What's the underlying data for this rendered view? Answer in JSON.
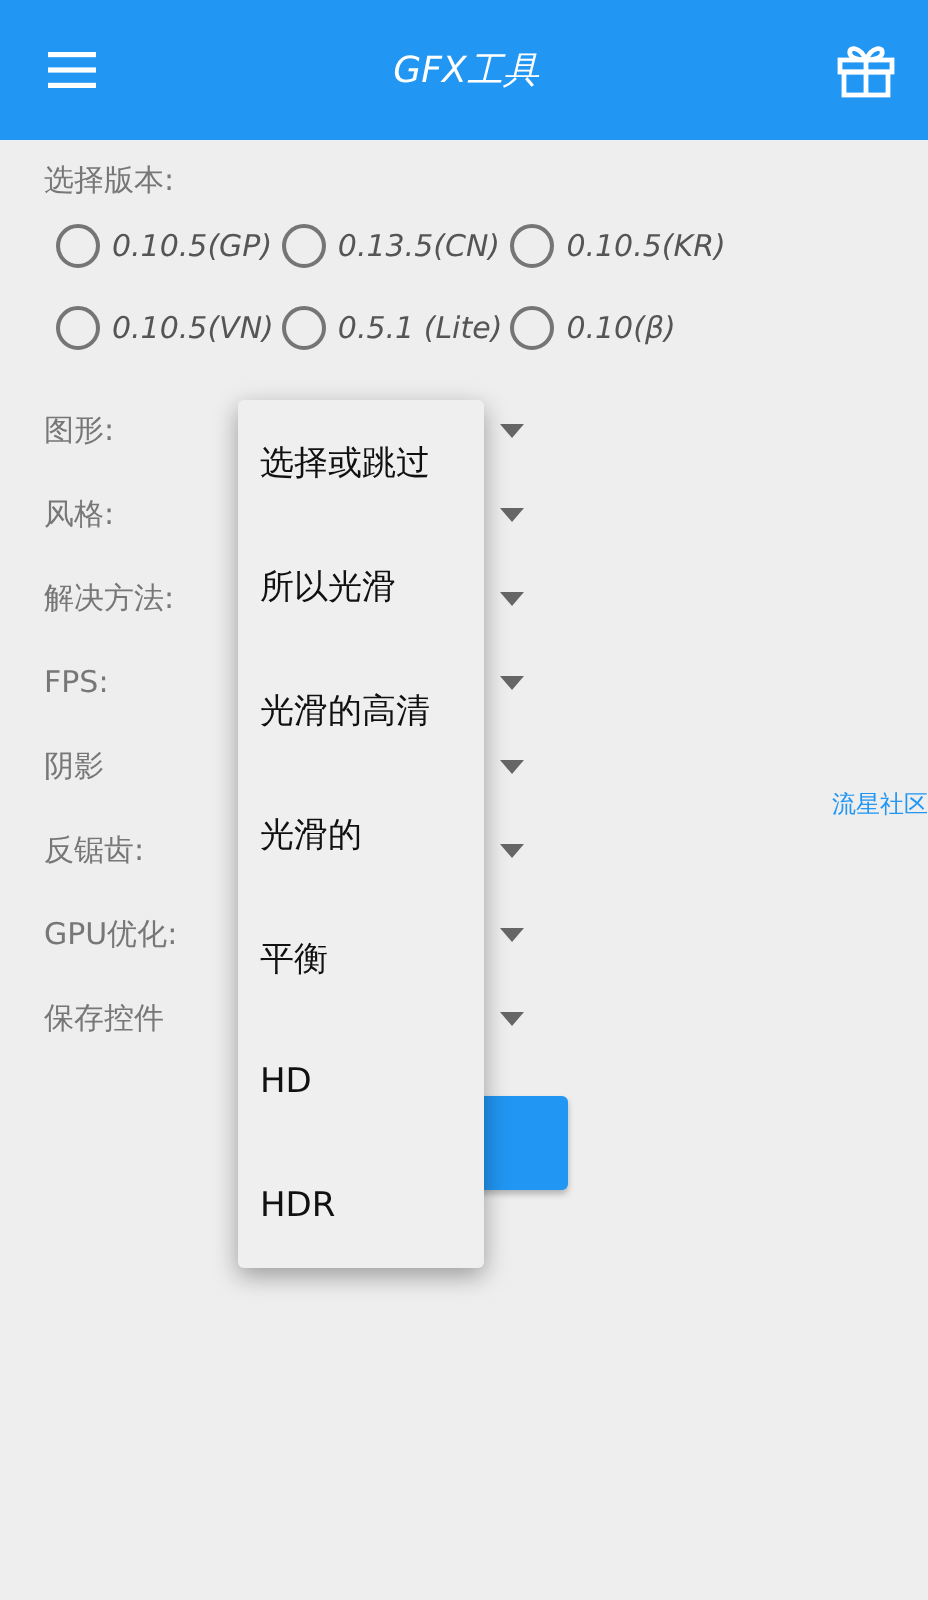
{
  "toolbar": {
    "title": "GFX工具"
  },
  "version": {
    "label": "选择版本:",
    "options": [
      {
        "label": "0.10.5(GP)",
        "selected": false
      },
      {
        "label": "0.13.5(CN)",
        "selected": false
      },
      {
        "label": "0.10.5(KR)",
        "selected": false
      },
      {
        "label": "0.10.5(VN)",
        "selected": false
      },
      {
        "label": "0.5.1 (Lite)",
        "selected": false
      },
      {
        "label": "0.10(β)",
        "selected": false
      }
    ]
  },
  "settings": [
    {
      "label": "图形:"
    },
    {
      "label": "风格:"
    },
    {
      "label": "解决方法:"
    },
    {
      "label": "FPS:"
    },
    {
      "label": "阴影"
    },
    {
      "label": "反锯齿:"
    },
    {
      "label": "GPU优化:"
    },
    {
      "label": "保存控件"
    }
  ],
  "community_link": "流星社区",
  "dropdown_menu": {
    "items": [
      {
        "label": "选择或跳过"
      },
      {
        "label": "所以光滑"
      },
      {
        "label": "光滑的高清"
      },
      {
        "label": "光滑的"
      },
      {
        "label": "平衡"
      },
      {
        "label": "HD"
      },
      {
        "label": "HDR"
      }
    ]
  }
}
